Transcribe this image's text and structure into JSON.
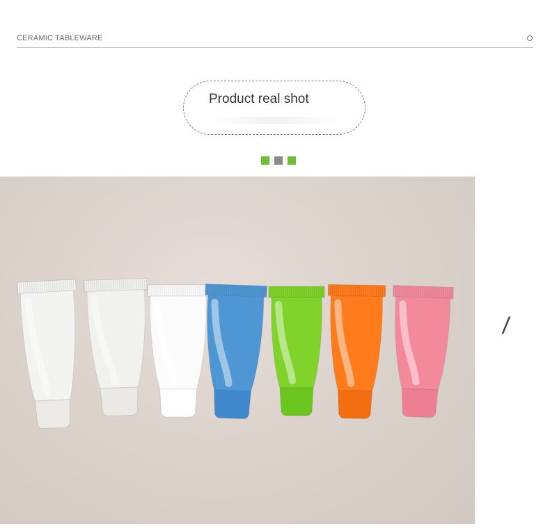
{
  "header": {
    "title": "CERAMIC TABLEWARE"
  },
  "banner": {
    "label": "Product real shot"
  },
  "dots": {
    "colors": [
      "#6cbf2e",
      "#8a8a8a",
      "#6cbf2e"
    ]
  },
  "photo": {
    "tubes": [
      {
        "name": "clear-tube-1",
        "color": "#f3f3f1",
        "cap": "#eceae6"
      },
      {
        "name": "clear-tube-2",
        "color": "#f1f1ef",
        "cap": "#ebe9e5"
      },
      {
        "name": "white-tube",
        "color": "#fbfbfb",
        "cap": "#ffffff"
      },
      {
        "name": "blue-tube",
        "color": "#4f97d4",
        "cap": "#3f89cc"
      },
      {
        "name": "green-tube",
        "color": "#7fd32b",
        "cap": "#6cc61f"
      },
      {
        "name": "orange-tube",
        "color": "#ff7b1c",
        "cap": "#f26e10"
      },
      {
        "name": "pink-tube",
        "color": "#f28a9c",
        "cap": "#ee7e92"
      }
    ]
  },
  "aside": {
    "slash": "/"
  }
}
